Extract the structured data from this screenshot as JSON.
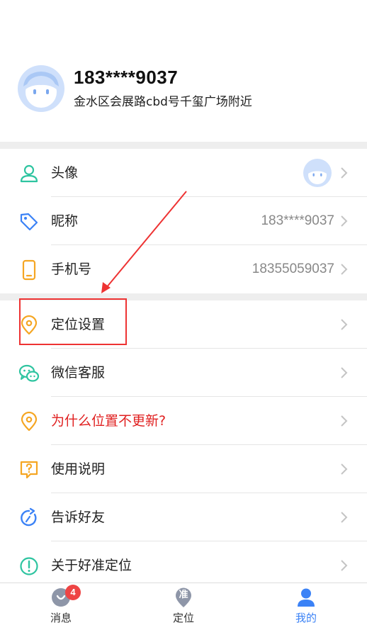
{
  "profile": {
    "phone": "183****9037",
    "address": "金水区会展路cbd号千玺广场附近"
  },
  "settings": [
    {
      "label": "头像",
      "icon": "user-icon"
    },
    {
      "label": "昵称",
      "value": "183****9037",
      "icon": "tag-icon"
    },
    {
      "label": "手机号",
      "value": "18355059037",
      "icon": "phone-icon"
    }
  ],
  "menu": [
    {
      "label": "定位设置",
      "icon": "location-pin-icon"
    },
    {
      "label": "微信客服",
      "icon": "wechat-icon"
    },
    {
      "label": "为什么位置不更新?",
      "icon": "location-pin-icon"
    },
    {
      "label": "使用说明",
      "icon": "help-icon"
    },
    {
      "label": "告诉好友",
      "icon": "share-icon"
    },
    {
      "label": "关于好准定位",
      "icon": "info-icon"
    }
  ],
  "tabbar": {
    "tabs": [
      {
        "label": "消息",
        "badge": "4",
        "icon": "message-icon"
      },
      {
        "label": "定位",
        "icon_text": "准",
        "icon": "location-tab-icon"
      },
      {
        "label": "我的",
        "icon": "profile-icon",
        "active": true
      }
    ]
  },
  "colors": {
    "accent": "#3b82f6",
    "green": "#2ec4a0",
    "orange": "#f5a623",
    "red": "#e02020",
    "annotation": "#ee3333"
  }
}
